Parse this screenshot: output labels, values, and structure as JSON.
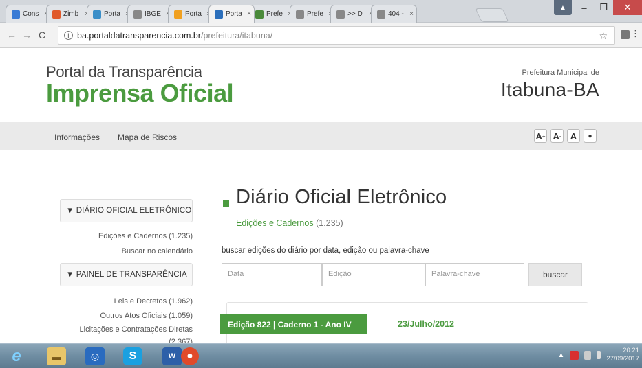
{
  "browser": {
    "tabs": [
      {
        "label": "Cons",
        "color": "#3a7bd5"
      },
      {
        "label": "Zimb",
        "color": "#e05a2b"
      },
      {
        "label": "Porta",
        "color": "#3a8ec8"
      },
      {
        "label": "IBGE",
        "color": "#888888"
      },
      {
        "label": "Porta",
        "color": "#f0a020"
      },
      {
        "label": "Porta",
        "color": "#2c6fbb",
        "active": true
      },
      {
        "label": "Prefe",
        "color": "#4a8a3a"
      },
      {
        "label": "Prefe",
        "color": "#888888"
      },
      {
        "label": ">> D",
        "color": "#888888"
      },
      {
        "label": "404 -",
        "color": "#888888"
      }
    ],
    "url_host": "ba.portaldatransparencia.com.br",
    "url_path": "/prefeitura/itabuna/"
  },
  "header": {
    "brand_top": "Portal da Transparência",
    "brand_main": "Imprensa Oficial",
    "pref_small": "Prefeitura Municipal de",
    "pref_big": "Itabuna-BA"
  },
  "nav": {
    "info": "Informações",
    "map": "Mapa de Riscos",
    "font_increase": "A",
    "font_decrease": "A",
    "font_reset": "A",
    "contrast": "●"
  },
  "sidebar": {
    "diario_header": "▼ DIÁRIO OFICIAL ELETRÔNICO",
    "diario_links": [
      "Edições e Cadernos (1.235)",
      "Buscar no calendário"
    ],
    "painel_header": "▼ PAINEL DE TRANSPARÊNCIA",
    "painel_links": [
      "Leis e Decretos (1.962)",
      "Outros Atos Oficiais (1.059)",
      "Licitações e Contratações Diretas",
      "(2.367)"
    ]
  },
  "main": {
    "title": "Diário Oficial Eletrônico",
    "sub_link": "Edições e Cadernos",
    "sub_count": "(1.235)",
    "search_label": "buscar edições do diário por data, edição ou palavra-chave",
    "placeholder_date": "Data",
    "placeholder_edition": "Edição",
    "placeholder_keyword": "Palavra-chave",
    "search_button": "buscar",
    "edition_badge": "Edição 822 | Caderno 1 - Ano IV",
    "edition_date": "23/Julho/2012"
  },
  "taskbar": {
    "time": "20:21",
    "date": "27/09/2017"
  }
}
